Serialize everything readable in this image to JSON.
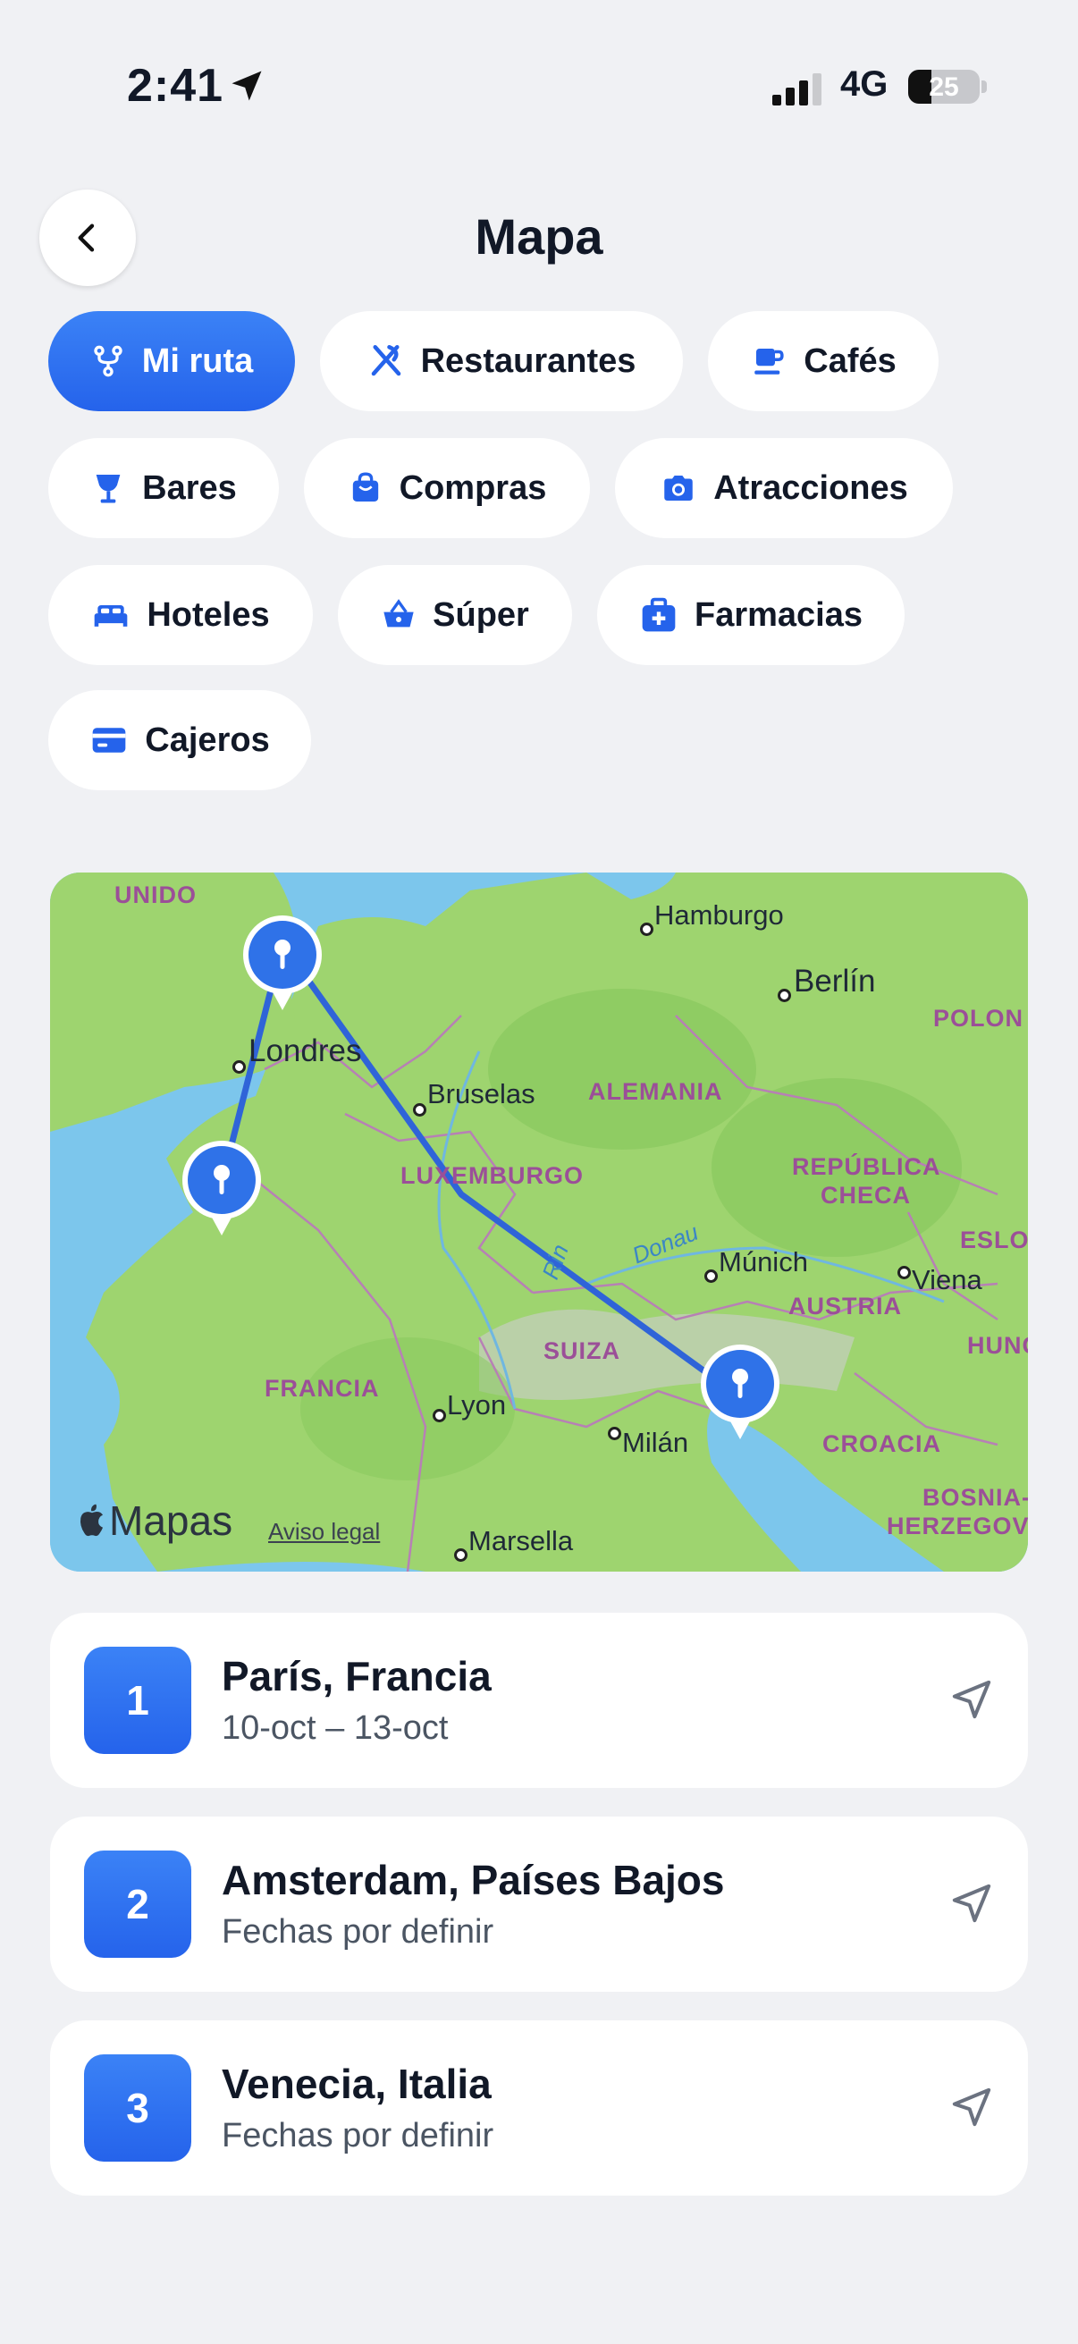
{
  "status_bar": {
    "time": "2:41",
    "network": "4G",
    "battery": "25"
  },
  "header": {
    "title": "Mapa"
  },
  "chips": [
    {
      "label": "Mi ruta",
      "icon": "route-icon",
      "active": true
    },
    {
      "label": "Restaurantes",
      "icon": "fork-knife-icon"
    },
    {
      "label": "Cafés",
      "icon": "coffee-cup-icon"
    },
    {
      "label": "Bares",
      "icon": "cocktail-glass-icon"
    },
    {
      "label": "Compras",
      "icon": "shopping-bag-icon"
    },
    {
      "label": "Atracciones",
      "icon": "camera-icon"
    },
    {
      "label": "Hoteles",
      "icon": "bed-icon"
    },
    {
      "label": "Súper",
      "icon": "basket-icon"
    },
    {
      "label": "Farmacias",
      "icon": "first-aid-kit-icon"
    },
    {
      "label": "Cajeros",
      "icon": "credit-card-icon"
    }
  ],
  "map": {
    "cities": [
      "Hamburgo",
      "Berlín",
      "Londres",
      "Bruselas",
      "Múnich",
      "Viena",
      "Lyon",
      "Milán",
      "Marsella"
    ],
    "countries": [
      "UNIDO",
      "POLON",
      "ALEMANIA",
      "LUXEMBURGO",
      "REPÚBLICA",
      "CHECA",
      "ESLOV",
      "AUSTRIA",
      "HUNG",
      "SUIZA",
      "FRANCIA",
      "CROACIA",
      "BOSNIA-",
      "HERZEGOVI"
    ],
    "rivers": [
      "Rin",
      "Donau"
    ],
    "logo": "Mapas",
    "legal": "Aviso legal"
  },
  "destinations": [
    {
      "number": "1",
      "name": "París, Francia",
      "dates": "10-oct – 13-oct"
    },
    {
      "number": "2",
      "name": "Amsterdam, Países Bajos",
      "dates": "Fechas por definir"
    },
    {
      "number": "3",
      "name": "Venecia, Italia",
      "dates": "Fechas por definir"
    }
  ],
  "colors": {
    "accent": "#2563eb",
    "background": "#f0f1f4",
    "route": "#2f64d8"
  }
}
